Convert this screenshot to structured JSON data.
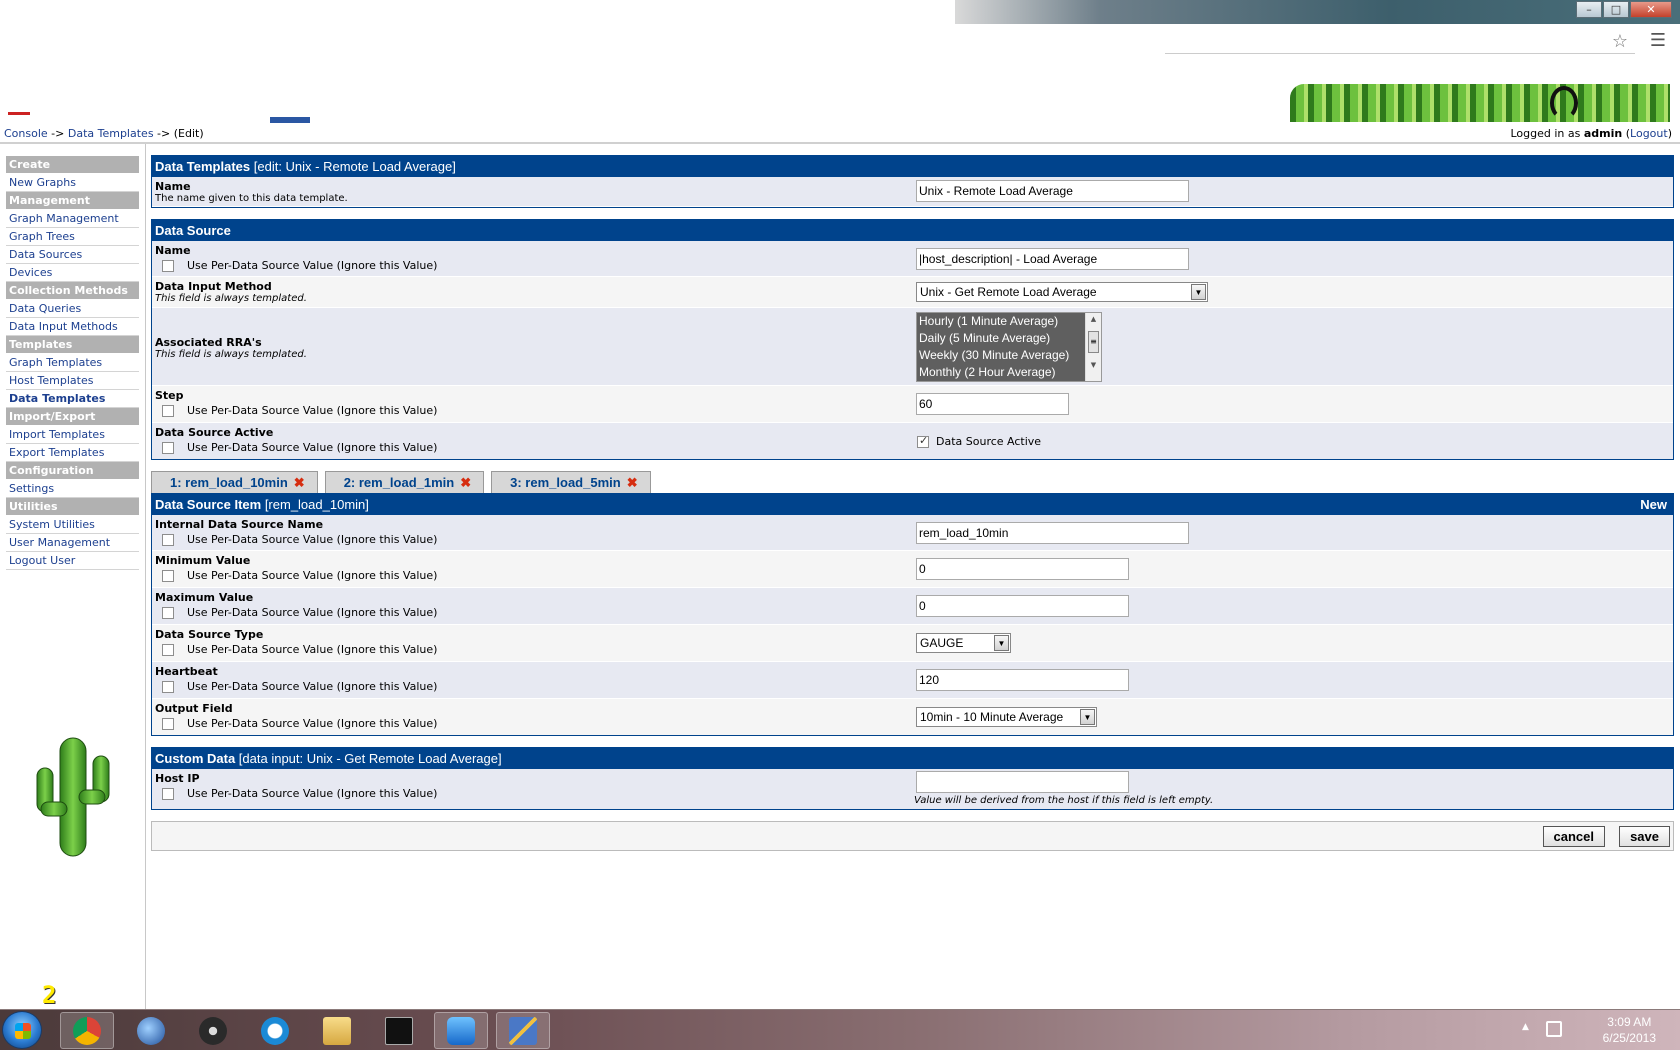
{
  "breadcrumb": {
    "console": "Console",
    "sep1": " -> ",
    "data_templates": "Data Templates",
    "sep2": " -> ",
    "edit": "(Edit)",
    "logged_in_prefix": "Logged in as ",
    "user": "admin",
    "logout_open": " (",
    "logout": "Logout",
    "logout_close": ")"
  },
  "sidebar": {
    "groups": [
      {
        "header": "Create",
        "items": [
          {
            "label": "New Graphs"
          }
        ]
      },
      {
        "header": "Management",
        "items": [
          {
            "label": "Graph Management"
          },
          {
            "label": "Graph Trees"
          },
          {
            "label": "Data Sources"
          },
          {
            "label": "Devices"
          }
        ]
      },
      {
        "header": "Collection Methods",
        "items": [
          {
            "label": "Data Queries"
          },
          {
            "label": "Data Input Methods"
          }
        ]
      },
      {
        "header": "Templates",
        "items": [
          {
            "label": "Graph Templates"
          },
          {
            "label": "Host Templates"
          },
          {
            "label": "Data Templates"
          }
        ]
      },
      {
        "header": "Import/Export",
        "items": [
          {
            "label": "Import Templates"
          },
          {
            "label": "Export Templates"
          }
        ]
      },
      {
        "header": "Configuration",
        "items": [
          {
            "label": "Settings"
          }
        ]
      },
      {
        "header": "Utilities",
        "items": [
          {
            "label": "System Utilities"
          },
          {
            "label": "User Management"
          },
          {
            "label": "Logout User"
          }
        ]
      }
    ],
    "badge": "2"
  },
  "template_box": {
    "header": "Data Templates",
    "header_sub": " [edit: Unix - Remote Load Average]",
    "name_title": "Name",
    "name_desc": "The name given to this data template.",
    "name_value": "Unix - Remote Load Average"
  },
  "data_source": {
    "header": "Data Source",
    "per_ds_label": "Use Per-Data Source Value (Ignore this Value)",
    "templated_note": "This field is always templated.",
    "name_title": "Name",
    "name_value": "|host_description| - Load Average",
    "input_method_title": "Data Input Method",
    "input_method_value": "Unix - Get Remote Load Average",
    "rra_title": "Associated RRA's",
    "rra_options": [
      "Hourly (1 Minute Average)",
      "Daily (5 Minute Average)",
      "Weekly (30 Minute Average)",
      "Monthly (2 Hour Average)"
    ],
    "step_title": "Step",
    "step_value": "60",
    "active_title": "Data Source Active",
    "active_label": "Data Source Active"
  },
  "tabs": [
    {
      "label": "1: rem_load_10min",
      "close": "✖"
    },
    {
      "label": "2: rem_load_1min",
      "close": "✖"
    },
    {
      "label": "3: rem_load_5min",
      "close": "✖"
    }
  ],
  "item_box": {
    "header": "Data Source Item",
    "header_sub": " [rem_load_10min]",
    "new_label": "New",
    "internal_name_title": "Internal Data Source Name",
    "internal_name_value": "rem_load_10min",
    "min_title": "Minimum Value",
    "min_value": "0",
    "max_title": "Maximum Value",
    "max_value": "0",
    "type_title": "Data Source Type",
    "type_value": "GAUGE",
    "heartbeat_title": "Heartbeat",
    "heartbeat_value": "120",
    "output_title": "Output Field",
    "output_value": "10min - 10 Minute Average"
  },
  "custom_box": {
    "header": "Custom Data",
    "header_sub": " [data input: Unix - Get Remote Load Average]",
    "host_ip_title": "Host IP",
    "host_ip_value": "",
    "host_ip_hint": "Value will be derived from the host if this field is left empty."
  },
  "actions": {
    "cancel": "cancel",
    "save": "save"
  },
  "taskbar": {
    "time": "3:09 AM",
    "date": "6/25/2013"
  },
  "colors": {
    "header_blue": "#00438c",
    "link_blue": "#1c3f8f",
    "nav_header_gray": "#b1b1b1",
    "tab_close_red": "#d62d10"
  }
}
